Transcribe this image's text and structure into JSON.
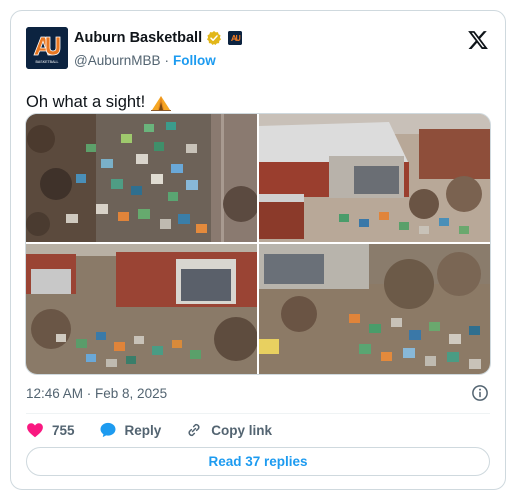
{
  "author": {
    "display_name": "Auburn Basketball",
    "handle": "@AuburnMBB",
    "separator": "·",
    "follow_label": "Follow",
    "avatar_caption": "BASKETBALL"
  },
  "tweet": {
    "text": "Oh what a sight!",
    "timestamp": "12:46 AM · Feb 8, 2025"
  },
  "actions": {
    "like_count": "755",
    "reply_label": "Reply",
    "copy_link_label": "Copy link"
  },
  "read_replies_label": "Read 37 replies",
  "icons": {
    "x_logo": "x-logo-icon",
    "verified": "gold-verified-badge-icon",
    "info": "info-icon",
    "heart": "heart-icon",
    "reply": "reply-bubble-icon",
    "link": "link-icon",
    "tent": "tent-emoji"
  },
  "colors": {
    "accent": "#1d9bf0",
    "heart": "#f91880",
    "verified": "#e2b719",
    "auburn_navy": "#0c2340",
    "auburn_orange": "#e87722"
  }
}
